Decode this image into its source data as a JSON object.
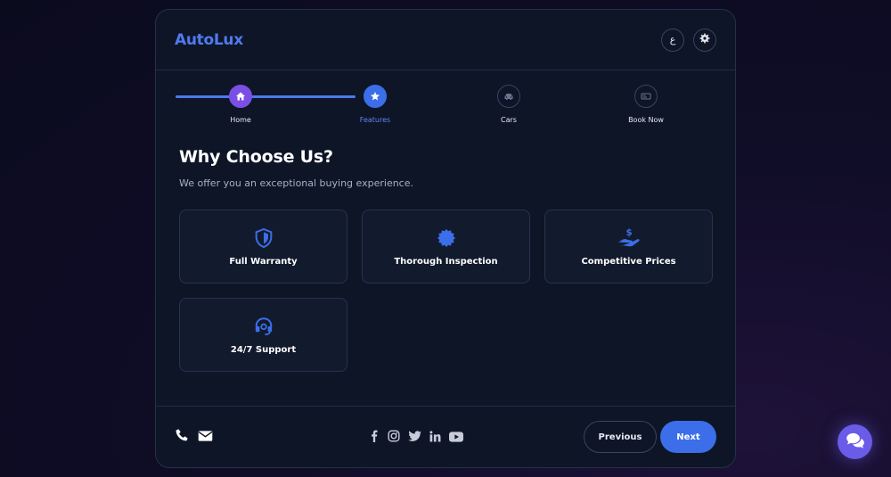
{
  "header": {
    "logo": "AutoLux",
    "language_label": "ع",
    "settings_icon": "gear-icon"
  },
  "stepper": {
    "current_step": 2,
    "progress": 0.333,
    "steps": [
      {
        "label": "Home",
        "icon": "home-icon"
      },
      {
        "label": "Features",
        "icon": "star-icon"
      },
      {
        "label": "Cars",
        "icon": "car-icon"
      },
      {
        "label": "Book Now",
        "icon": "ticket-icon"
      }
    ]
  },
  "main": {
    "title": "Why Choose Us?",
    "subtitle": "We offer you an exceptional buying experience.",
    "features": [
      {
        "label": "Full Warranty",
        "icon": "shield-icon"
      },
      {
        "label": "Thorough Inspection",
        "icon": "certificate-icon"
      },
      {
        "label": "Competitive Prices",
        "icon": "hand-dollar-icon"
      },
      {
        "label": "24/7 Support",
        "icon": "headset-icon"
      }
    ]
  },
  "footer": {
    "contact_icons": [
      "phone-icon",
      "envelope-icon"
    ],
    "social_icons": [
      "facebook-icon",
      "instagram-icon",
      "twitter-icon",
      "linkedin-icon",
      "youtube-icon"
    ],
    "previous_label": "Previous",
    "next_label": "Next"
  },
  "chat": {
    "icon": "chat-icon"
  },
  "colors": {
    "accent": "#3b6ee8",
    "accent_purple": "#7b4fe6",
    "card_bg": "#0e1527",
    "logo": "#4f7bf0"
  }
}
